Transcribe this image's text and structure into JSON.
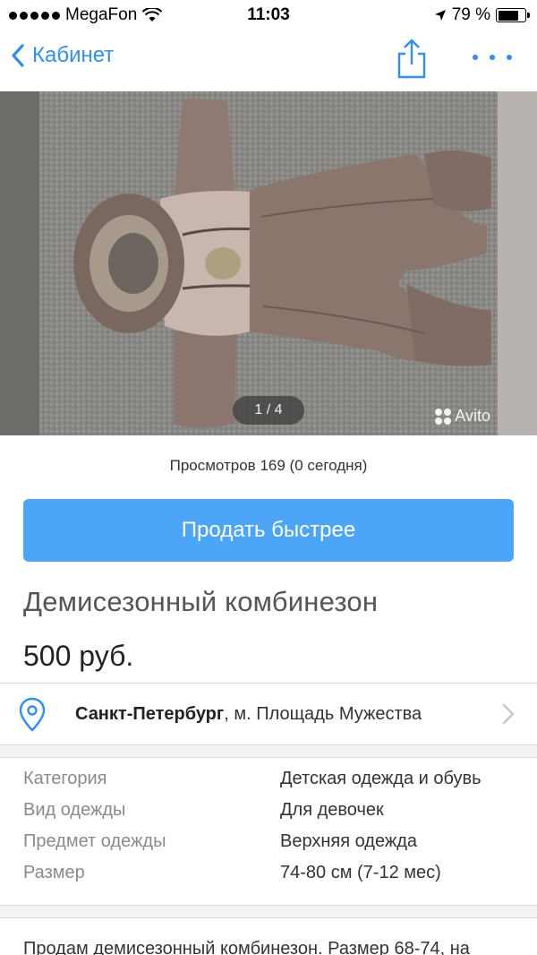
{
  "status_bar": {
    "carrier": "MegaFon",
    "time": "11:03",
    "battery": "79 %",
    "battery_level": 0.79
  },
  "nav": {
    "back_label": "Кабинет"
  },
  "gallery": {
    "counter": "1 / 4",
    "watermark": "Avito"
  },
  "views": "Просмотров 169 (0 сегодня)",
  "sell_button": "Продать быстрее",
  "title": "Демисезонный комбинезон",
  "price": "500 руб.",
  "location": {
    "city": "Санкт-Петербург",
    "metro": ", м. Площадь Мужества"
  },
  "params": [
    {
      "label": "Категория",
      "value": "Детская одежда и обувь"
    },
    {
      "label": "Вид одежды",
      "value": "Для девочек"
    },
    {
      "label": "Предмет одежды",
      "value": "Верхняя одежда"
    },
    {
      "label": "Размер",
      "value": "74-80 см (7-12 мес)"
    }
  ],
  "description": "Продам демисезонный комбинезон. Размер 68-74, на",
  "colors": {
    "accent": "#2f8ff5",
    "button": "#4da5f7"
  }
}
